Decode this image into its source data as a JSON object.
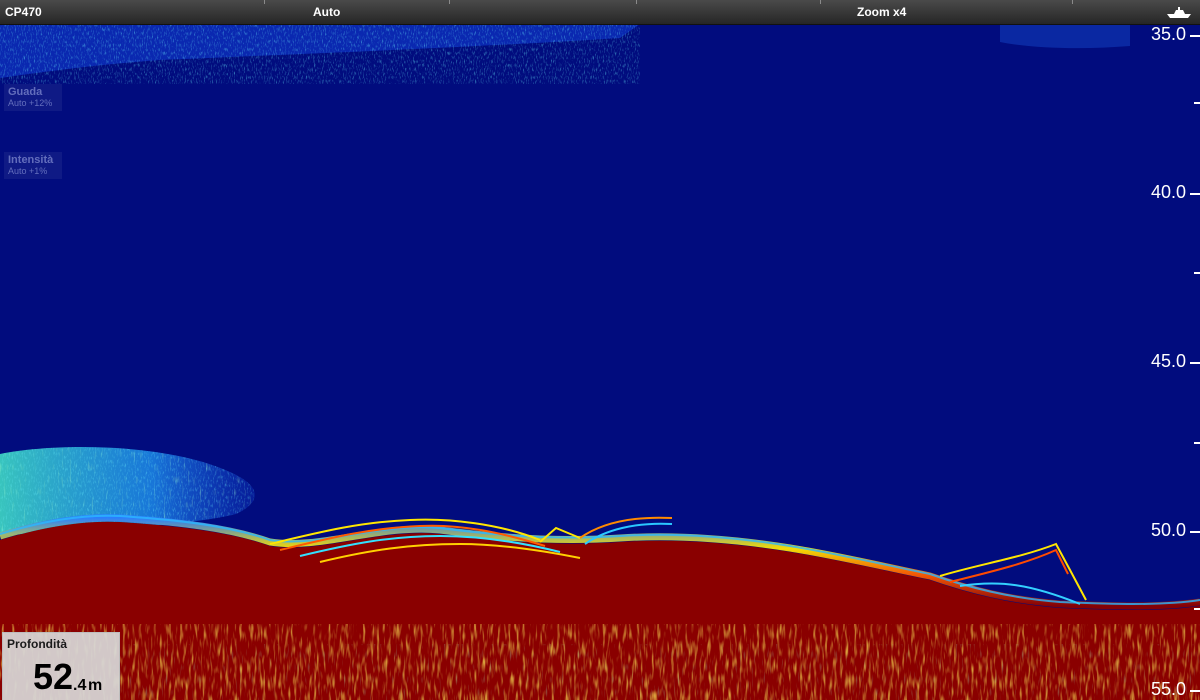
{
  "topbar": {
    "source_label": "CP470",
    "mode_label": "Auto",
    "zoom_label": "Zoom x4",
    "boat_icon": "boat-icon"
  },
  "overlays": {
    "gain": {
      "title": "Guada",
      "value": "Auto +12%"
    },
    "intensity": {
      "title": "Intensità",
      "value": "Auto +1%"
    }
  },
  "depth_scale": {
    "labels": [
      "35.0",
      "40.0",
      "45.0",
      "50.0",
      "55.0"
    ]
  },
  "depth_readout": {
    "title": "Profondità",
    "integer": "52",
    "decimal": ".4",
    "unit": "m"
  },
  "colors": {
    "water": "#010c7e",
    "bottom": "#8a0000",
    "echo_weak": "#2aa8ff",
    "echo_mid": "#ffe600",
    "echo_strong": "#ff4a00"
  }
}
